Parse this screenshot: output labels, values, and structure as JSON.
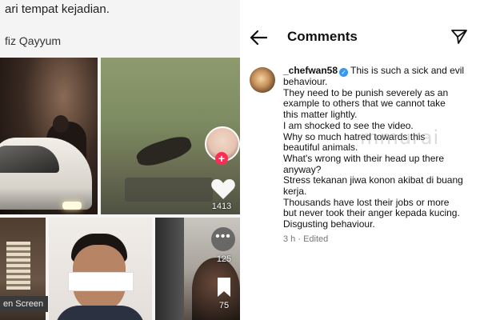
{
  "left": {
    "top_text": "ari tempat kejadian.",
    "author": "fiz Qayyum",
    "tiles": {
      "cat_video": {
        "like_count": "1413"
      },
      "screen_label": "en Screen",
      "phone_video": {
        "comment_count": "125",
        "save_count": "75"
      }
    }
  },
  "right": {
    "header_title": "Comments",
    "comment": {
      "username": "_chefwan58",
      "lines": [
        "This is such a sick and evil",
        "behaviour.",
        "They need to be punish severely as an",
        "example to others that we cannot take",
        "this matter lightly.",
        "I am shocked to see the video.",
        "Why so much hatred towards this",
        "beautiful animals.",
        "What's wrong with their head up there",
        "anyway?",
        "Stress tekanan jiwa konon akibat di buang",
        "kerja.",
        "Thousands have lost their jobs or more",
        "but never took their anger kepada kucing.",
        "Disgusting behaviour."
      ],
      "meta": "3 h · Edited"
    },
    "watermark": "mmurai"
  },
  "colors": {
    "verified": "#3897f0",
    "tiktok_accent": "#fe2c55",
    "meta_text": "#777777"
  },
  "icons": [
    "back-arrow-icon",
    "share-icon",
    "verified-icon",
    "heart-icon",
    "plus-icon",
    "more-icon",
    "bookmark-icon"
  ]
}
